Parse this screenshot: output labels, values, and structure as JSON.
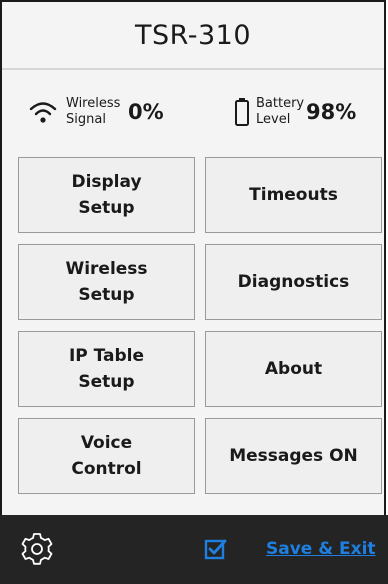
{
  "header": {
    "title": "TSR-310"
  },
  "status": {
    "wireless": {
      "label": "Wireless\nSignal",
      "value": "0%",
      "icon": "wifi-icon"
    },
    "battery": {
      "label": "Battery\nLevel",
      "value": "98%",
      "icon": "battery-icon"
    }
  },
  "menu": {
    "display_setup": "Display\nSetup",
    "timeouts": "Timeouts",
    "wireless_setup": "Wireless\nSetup",
    "diagnostics": "Diagnostics",
    "ip_table_setup": "IP Table\nSetup",
    "about": "About",
    "voice_control": "Voice\nControl",
    "messages": "Messages ON"
  },
  "footer": {
    "settings_icon": "gear-icon",
    "confirm_icon": "checkbox-checked-icon",
    "save_label": "Save & Exit",
    "accent_color": "#1e7fe0"
  }
}
